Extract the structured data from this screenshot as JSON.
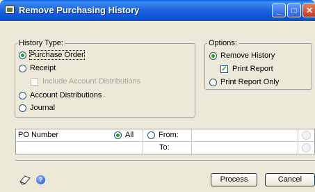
{
  "window": {
    "title": "Remove Purchasing History"
  },
  "history_type": {
    "legend": "History Type:",
    "purchase_order": "Purchase Order",
    "receipt": "Receipt",
    "include_account_distributions": "Include Account Distributions",
    "account_distributions": "Account Distributions",
    "journal": "Journal",
    "selected": "Purchase Order"
  },
  "options": {
    "legend": "Options:",
    "remove_history": "Remove History",
    "print_report": "Print Report",
    "print_report_only": "Print Report Only",
    "selected": "Remove History",
    "print_report_checked": true
  },
  "range": {
    "field": "PO Number",
    "all": "All",
    "from": "From:",
    "to": "To:",
    "selected": "All"
  },
  "buttons": {
    "process": "Process",
    "cancel": "Cancel"
  }
}
